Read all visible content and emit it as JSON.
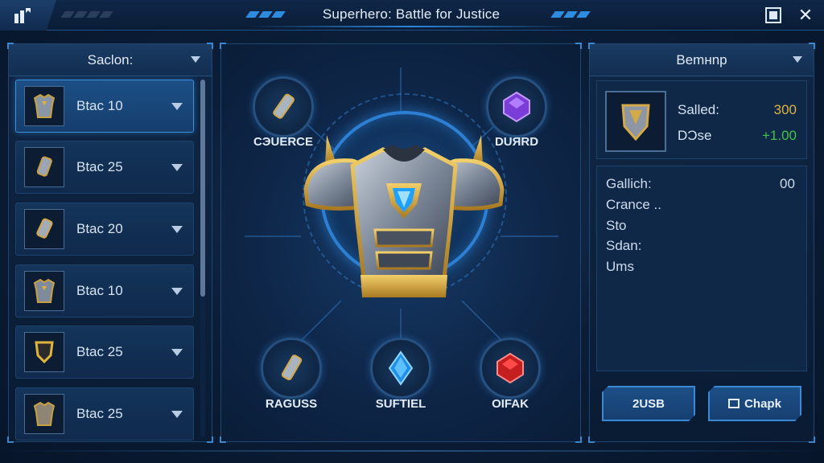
{
  "header": {
    "title": "Superhero: Battle for Justice"
  },
  "left_panel": {
    "header": "Saclon:",
    "items": [
      {
        "label": "Btac 10",
        "icon": "chest-armor-icon",
        "selected": true
      },
      {
        "label": "Btac 25",
        "icon": "gauntlet-icon"
      },
      {
        "label": "Btac 20",
        "icon": "gauntlet-icon"
      },
      {
        "label": "Btac 10",
        "icon": "chest-armor-icon"
      },
      {
        "label": "Btac 25",
        "icon": "shield-icon"
      },
      {
        "label": "Btac 25",
        "icon": "chest-armor-icon"
      }
    ]
  },
  "center": {
    "slots": [
      {
        "label": "CЭUERCE",
        "icon": "gauntlet-icon"
      },
      {
        "label": "DUЯRD",
        "icon": "purple-gem-icon"
      },
      {
        "label": "RAGUSS",
        "icon": "gauntlet-icon"
      },
      {
        "label": "SUFTIEL",
        "icon": "blue-gem-icon"
      },
      {
        "label": "OIFAK",
        "icon": "red-gem-icon"
      }
    ]
  },
  "right_panel": {
    "header": "Bemнnp",
    "stats": [
      {
        "label": "Salled:",
        "value": "300",
        "color": "#e0b43c"
      },
      {
        "label": "DƆse",
        "value": "+1.00",
        "color": "#3fc24e"
      }
    ],
    "info": {
      "lines": [
        "Gallich:",
        "Crance ..",
        "Sto",
        "Sdan:",
        "Ums"
      ],
      "gallich_value": "00"
    },
    "buttons": {
      "left": "2USB",
      "right": "Chapk"
    }
  },
  "colors": {
    "accent": "#2c7fd2",
    "gold": "#e0b43c",
    "green": "#3fc24e"
  }
}
